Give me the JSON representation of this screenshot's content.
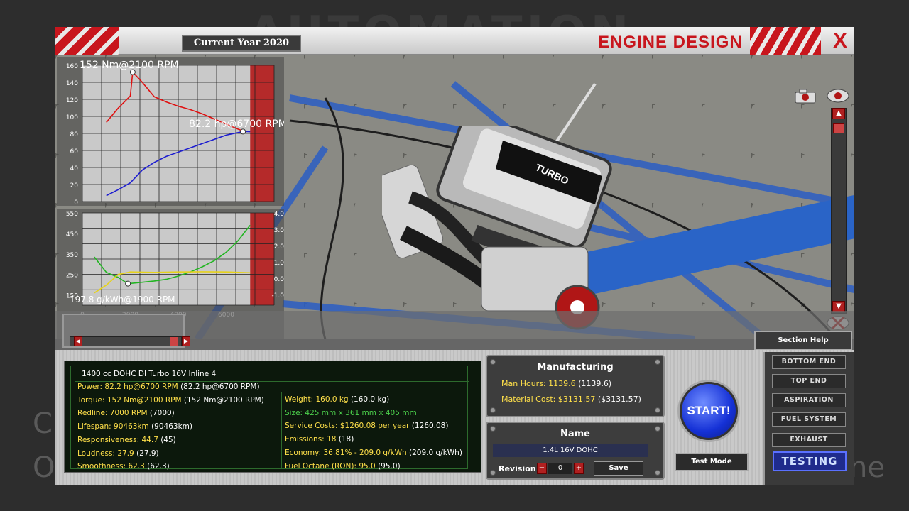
{
  "background": {
    "logo_text": "AUTOMATION",
    "left_text_1": "C",
    "left_text_2": "O",
    "right_text": "ne"
  },
  "header": {
    "year_label": "Current Year 2020",
    "title": "ENGINE DESIGN",
    "close_label": "X"
  },
  "charts": {
    "upper": {
      "type": "line",
      "y_ticks": [
        "160",
        "140",
        "120",
        "100",
        "80",
        "60",
        "40",
        "20",
        "0"
      ],
      "torque_peak_label": "152 Nm@2100 RPM",
      "power_peak_label": "82.2 hp@6700 RPM",
      "series": [
        {
          "name": "torque",
          "color": "#e01010",
          "x": [
            1000,
            1500,
            2000,
            2100,
            2500,
            3000,
            3500,
            4000,
            4500,
            5000,
            5500,
            6000,
            6500,
            6700,
            7000
          ],
          "values": [
            93,
            110,
            124,
            152,
            140,
            123,
            117,
            112,
            108,
            103,
            97,
            91,
            85,
            83,
            82
          ]
        },
        {
          "name": "power",
          "color": "#1d1dd0",
          "x": [
            1000,
            1500,
            2000,
            2500,
            3000,
            3500,
            4000,
            4500,
            5000,
            5500,
            6000,
            6500,
            6700,
            7000
          ],
          "values": [
            7,
            14,
            22,
            37,
            46,
            53,
            58,
            63,
            68,
            73,
            78,
            81,
            82.2,
            82
          ]
        }
      ],
      "xlim": [
        0,
        8000
      ],
      "ylim": [
        0,
        160
      ],
      "redline_start": 7000
    },
    "lower": {
      "type": "line",
      "y_ticks_left": [
        "550",
        "450",
        "350",
        "250",
        "150"
      ],
      "y_ticks_right": [
        "4.0",
        "3.0",
        "2.0",
        "1.0",
        "0.0",
        "-1.0"
      ],
      "x_ticks": [
        "0",
        "2000",
        "4000",
        "6000"
      ],
      "bsfc_label": "197.8 g/kWh@1900 RPM",
      "series": [
        {
          "name": "efficiency",
          "color": "#22b522",
          "x": [
            500,
            1000,
            1500,
            1900,
            2500,
            3000,
            3500,
            4000,
            4500,
            5000,
            5500,
            6000,
            6500,
            7000
          ],
          "values": [
            335,
            260,
            235,
            205,
            212,
            218,
            226,
            242,
            262,
            287,
            317,
            358,
            415,
            490
          ]
        },
        {
          "name": "fuel",
          "color": "#e6d21b",
          "x": [
            500,
            1000,
            1500,
            2000,
            3000,
            4000,
            5000,
            6000,
            7000
          ],
          "values": [
            160,
            198,
            250,
            262,
            260,
            262,
            263,
            262,
            258
          ]
        }
      ],
      "xlim": [
        0,
        8000
      ],
      "ylim": [
        100,
        550
      ],
      "redline_start": 7000
    }
  },
  "stats": {
    "engine_title": "1400 cc DOHC DI Turbo 16V Inline 4",
    "left": [
      {
        "label": "Power:",
        "value": "82.2 hp@6700 RPM",
        "extra": "(82.2 hp@6700 RPM)"
      },
      {
        "label": "Torque:",
        "value": "152 Nm@2100 RPM",
        "extra": "(152 Nm@2100 RPM)"
      },
      {
        "label": "Redline:",
        "value": "7000 RPM",
        "extra": "(7000)"
      },
      {
        "label": "Lifespan:",
        "value": "90463km",
        "extra": "(90463km)"
      },
      {
        "label": "Responsiveness:",
        "value": "44.7",
        "extra": "(45)"
      },
      {
        "label": "Loudness:",
        "value": "27.9",
        "extra": "(27.9)"
      },
      {
        "label": "Smoothness:",
        "value": "62.3",
        "extra": "(62.3)"
      }
    ],
    "right": [
      {
        "label": "Weight:",
        "value": "160.0 kg",
        "extra": "(160.0 kg)"
      },
      {
        "label": "Size:",
        "value": "425 mm x 361 mm x 405 mm",
        "extra": ""
      },
      {
        "label": "Service Costs:",
        "value": "$1260.08 per year",
        "extra": "(1260.08)"
      },
      {
        "label": "Emissions:",
        "value": "18",
        "extra": "(18)"
      },
      {
        "label": "Economy:",
        "value": "36.81% - 209.0 g/kWh",
        "extra": "(209.0 g/kWh)"
      },
      {
        "label": "Fuel Octane (RON):",
        "value": "95.0",
        "extra": "(95.0)"
      }
    ]
  },
  "manufacturing": {
    "title": "Manufacturing",
    "man_hours_label": "Man Hours:",
    "man_hours_value": "1139.6",
    "man_hours_extra": "(1139.6)",
    "material_label": "Material Cost:",
    "material_value": "$3131.57",
    "material_extra": "($3131.57)"
  },
  "name_panel": {
    "title": "Name",
    "name_value": "1.4L 16V DOHC",
    "revision_label": "Revision",
    "revision_value": "0",
    "minus": "−",
    "plus": "+",
    "save_label": "Save"
  },
  "controls": {
    "start_label": "START!",
    "test_mode_label": "Test Mode",
    "section_help_label": "Section Help"
  },
  "nav": [
    {
      "label": "BOTTOM END"
    },
    {
      "label": "TOP END"
    },
    {
      "label": "ASPIRATION"
    },
    {
      "label": "FUEL SYSTEM"
    },
    {
      "label": "EXHAUST"
    }
  ],
  "nav_active": {
    "label": "TESTING"
  },
  "engine": {
    "cover_text": "TURBO"
  },
  "colors": {
    "accent": "#c8161d",
    "panel": "#3d3d3d",
    "stats_bg": "#0c180c",
    "label_yellow": "#ffe04a",
    "start_blue": "#1531d6"
  }
}
